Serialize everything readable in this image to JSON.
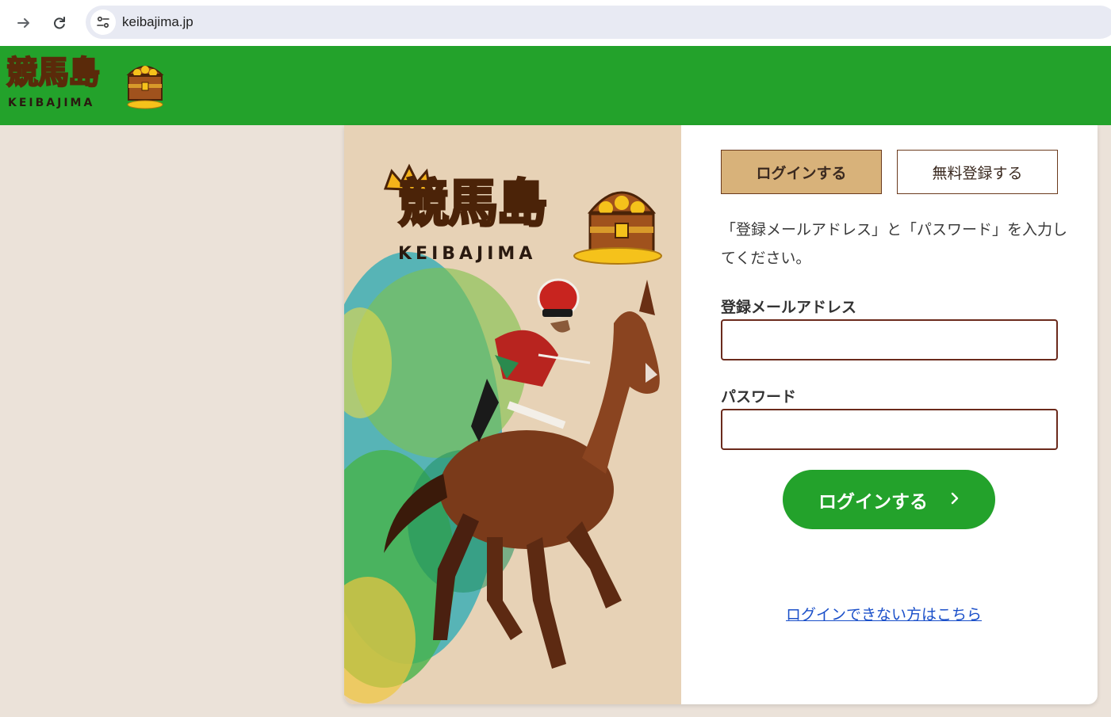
{
  "browser": {
    "url": "keibajima.jp",
    "forward_icon": "arrow-right-icon",
    "reload_icon": "reload-icon",
    "site_info_icon": "site-settings-icon"
  },
  "header": {
    "logo_kanji": "競馬島",
    "logo_roman": "KEIBAJIMA",
    "background_color": "#23a22b"
  },
  "hero": {
    "logo_kanji": "競馬島",
    "logo_roman": "KEIBAJIMA",
    "image": "racehorse-jockey-illustration"
  },
  "tabs": {
    "login_label": "ログインする",
    "register_label": "無料登録する",
    "active": "login"
  },
  "form": {
    "instruction": "「登録メールアドレス」と「パスワード」を入力してください。",
    "email_label": "登録メールアドレス",
    "email_value": "",
    "password_label": "パスワード",
    "password_value": "",
    "submit_label": "ログインする",
    "submit_icon": "chevron-right-icon",
    "help_link": "ログインできない方はこちら"
  },
  "colors": {
    "primary_green": "#23a22b",
    "tab_active": "#d8b27a",
    "input_border": "#6b2a1c",
    "page_bg": "#ebe2d9",
    "link": "#1a4fc9"
  }
}
